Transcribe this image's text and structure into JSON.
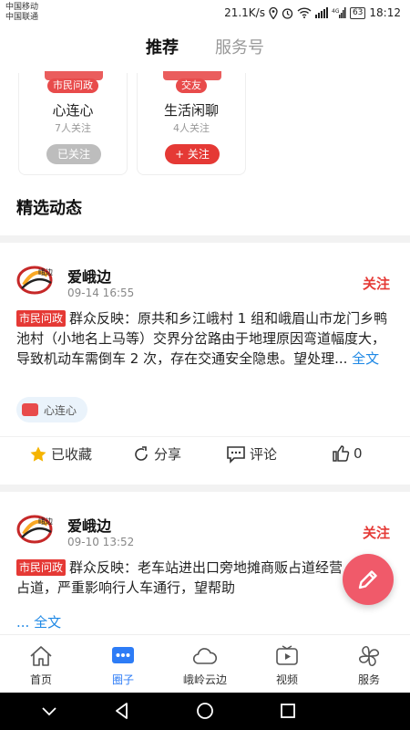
{
  "status_bar": {
    "carrier1": "中国移动",
    "carrier2": "中国联通",
    "speed": "21.1K/s",
    "battery": "63",
    "time": "18:12"
  },
  "top_tabs": [
    {
      "label": "推荐",
      "active": true
    },
    {
      "label": "服务号",
      "active": false
    }
  ],
  "circles": [
    {
      "tag": "市民问政",
      "name": "心连心",
      "count": "7人关注",
      "button": "已关注",
      "followed": true
    },
    {
      "tag": "交友",
      "name": "生活闲聊",
      "count": "4人关注",
      "button": "+ 关注",
      "followed": false
    }
  ],
  "section_title": "精选动态",
  "posts": [
    {
      "author": "爱峨边",
      "avatar_label": "峨边",
      "time": "09-14 16:55",
      "follow": "关注",
      "badge": "市民问政",
      "text": "群众反映：原共和乡江峨村 1 组和峨眉山市龙门乡鸭池村（小地名上马等）交界分岔路由于地理原因弯道幅度大，导致机动车需倒车 2 次，存在交通安全隐患。望处理...",
      "more": "全文",
      "circle": "心连心",
      "actions": {
        "favorite": "已收藏",
        "share": "分享",
        "comment": "评论",
        "likes": "0"
      }
    },
    {
      "author": "爱峨边",
      "avatar_label": "峨边",
      "time": "09-10 13:52",
      "follow": "关注",
      "badge": "市民问政",
      "text": "群众反映：老车站进出口旁地摊商贩占道经营，桌椅占道，严重影响行人车通行，望帮助",
      "more": "... 全文"
    }
  ],
  "bottom_nav": [
    {
      "label": "首页",
      "icon": "home-icon",
      "active": false
    },
    {
      "label": "圈子",
      "icon": "chat-dots-icon",
      "active": true
    },
    {
      "label": "峨岭云边",
      "icon": "cloud-icon",
      "active": false
    },
    {
      "label": "视频",
      "icon": "video-icon",
      "active": false
    },
    {
      "label": "服务",
      "icon": "clover-icon",
      "active": false
    }
  ],
  "colors": {
    "accent": "#e53935",
    "link": "#1e88e5",
    "nav_active": "#2d7cf6",
    "fab": "#f05a6a"
  }
}
